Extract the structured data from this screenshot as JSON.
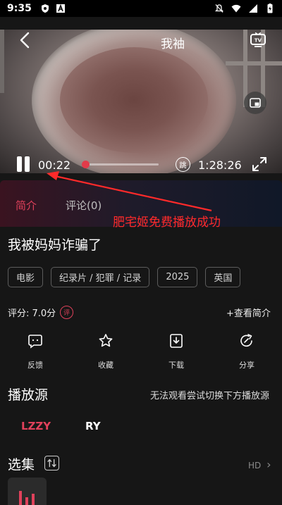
{
  "status_bar": {
    "time": "9:35",
    "left_icons": [
      "shield-icon",
      "a-box-icon"
    ],
    "right_icons": [
      "mute-icon",
      "wifi-icon",
      "signal-icon",
      "battery-icon"
    ]
  },
  "player": {
    "title_visible": "我袖",
    "current_time": "00:22",
    "total_time": "1:28:26",
    "skip_label": "跳",
    "progress_fraction": 0.0042,
    "accent_color": "#e23b4a"
  },
  "tabs": [
    {
      "label": "简介",
      "active": true
    },
    {
      "label": "评论(0)",
      "active": false
    }
  ],
  "annotation": {
    "text": "肥宅姬免费播放成功",
    "color": "#ff2a2a"
  },
  "details": {
    "title": "我被妈妈诈骗了",
    "tags": [
      "电影",
      "纪录片 / 犯罪 / 记录",
      "2025",
      "英国"
    ],
    "rating_label": "评分: 7.0分",
    "rating_badge": "评",
    "view_intro": "+查看简介"
  },
  "actions": [
    {
      "label": "反馈",
      "icon": "feedback-icon"
    },
    {
      "label": "收藏",
      "icon": "star-icon"
    },
    {
      "label": "下载",
      "icon": "download-icon"
    },
    {
      "label": "分享",
      "icon": "share-icon"
    }
  ],
  "sources": {
    "heading": "播放源",
    "hint": "无法观看尝试切换下方播放源",
    "items": [
      "LZZY",
      "RY"
    ],
    "active_color": "#e0415b"
  },
  "episodes": {
    "heading": "选集",
    "quality_label": "HD",
    "quality_chevron": "›"
  }
}
